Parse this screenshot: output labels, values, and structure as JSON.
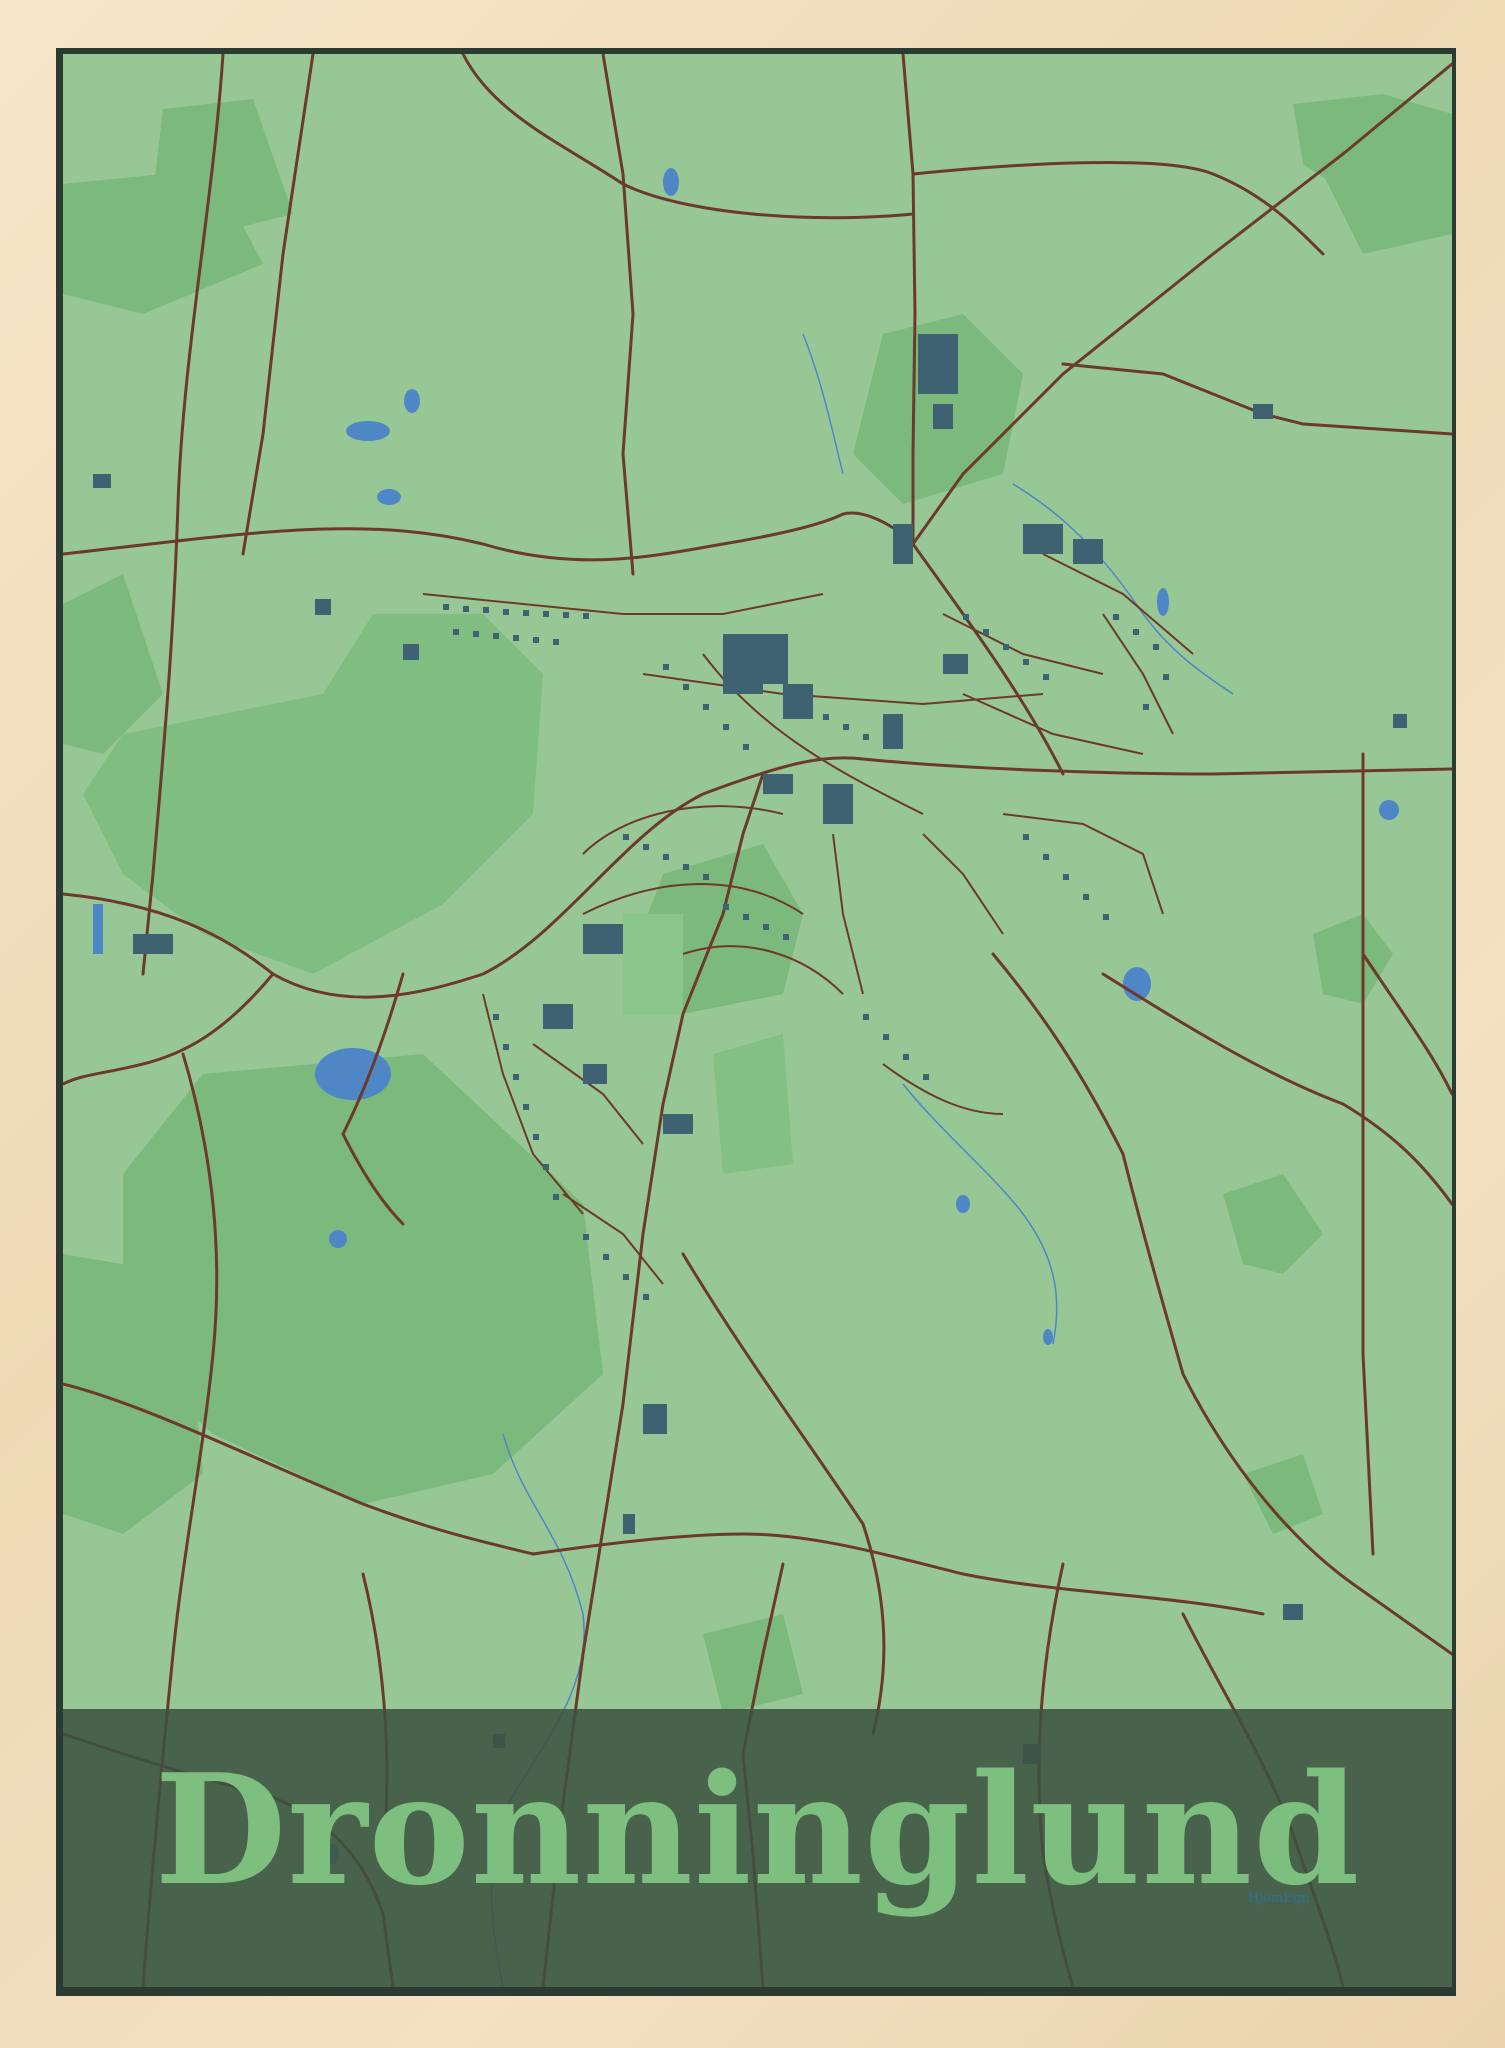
{
  "poster": {
    "title": "Dronninglund",
    "brand": "HjemEgn"
  },
  "colors": {
    "background": "#98c796",
    "forest": "#7cb97c",
    "roads": "#6b3a2a",
    "buildings": "#3f6273",
    "water": "#4f86c6",
    "title_band": "#3c5240",
    "title_text": "#7cbf7e",
    "frame": "#f2dfc0"
  }
}
